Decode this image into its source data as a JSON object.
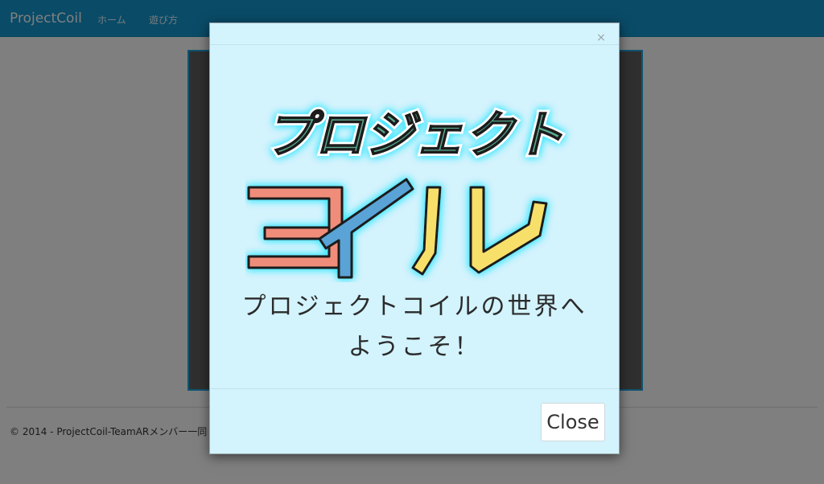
{
  "navbar": {
    "brand": "ProjectCoil",
    "links": [
      {
        "label": "ホーム"
      },
      {
        "label": "遊び方"
      }
    ]
  },
  "footer": {
    "text": "© 2014 - ProjectCoil-TeamARメンバー一同"
  },
  "modal": {
    "close_x": "×",
    "logo": {
      "line1": "プロジェクト",
      "line2": "コイル"
    },
    "welcome_line1": "プロジェクトコイルの世界へ",
    "welcome_line2": "ようこそ！",
    "close_label": "Close"
  },
  "colors": {
    "navbar": "#1497cf",
    "modal_bg": "#d3f3fd",
    "logo_line1": "#5aab8f",
    "logo_ko": "#f08d7a",
    "logo_i": "#5aa3d6",
    "logo_ru": "#f7e06a",
    "glow": "#35e6ff"
  }
}
